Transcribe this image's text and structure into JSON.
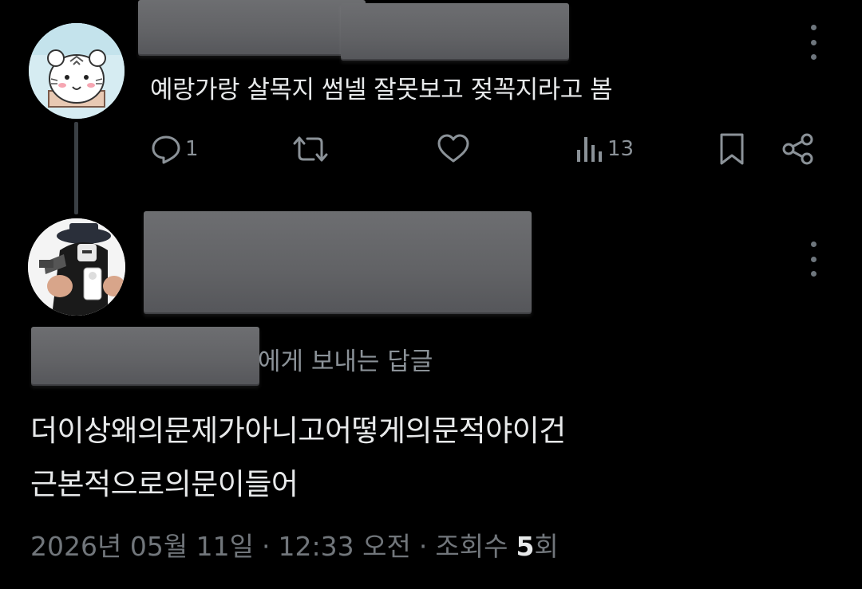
{
  "parent_post": {
    "text": "예랑가랑 살목지 썸넬 잘못보고 젖꼭지라고 봄",
    "actions": {
      "reply_count": "1",
      "repost_count": "",
      "like_count": "",
      "views_count": "13"
    }
  },
  "reply_post": {
    "reply_to_suffix": "에게 보내는 답글",
    "body_line1": "더이상왜의문제가아니고어떻게의문적야이건",
    "body_line2": "근본적으로의문이들어",
    "meta": {
      "date": "2026년 05월 11일",
      "separator1": "·",
      "time": "12:33 오전",
      "separator2": "·",
      "views_label": "조회수",
      "views_count": "5",
      "views_unit": "회"
    }
  },
  "icons": {
    "reply": "speech-bubble-icon",
    "repost": "repost-arrows-icon",
    "like": "heart-icon",
    "views": "bar-chart-icon",
    "bookmark": "bookmark-icon",
    "share": "share-nodes-icon",
    "more": "vertical-dots-icon"
  },
  "colors": {
    "background": "#000000",
    "text_primary": "#e7e9ea",
    "text_secondary": "#71767b",
    "icon": "#8b9298",
    "redaction": "#656669"
  }
}
